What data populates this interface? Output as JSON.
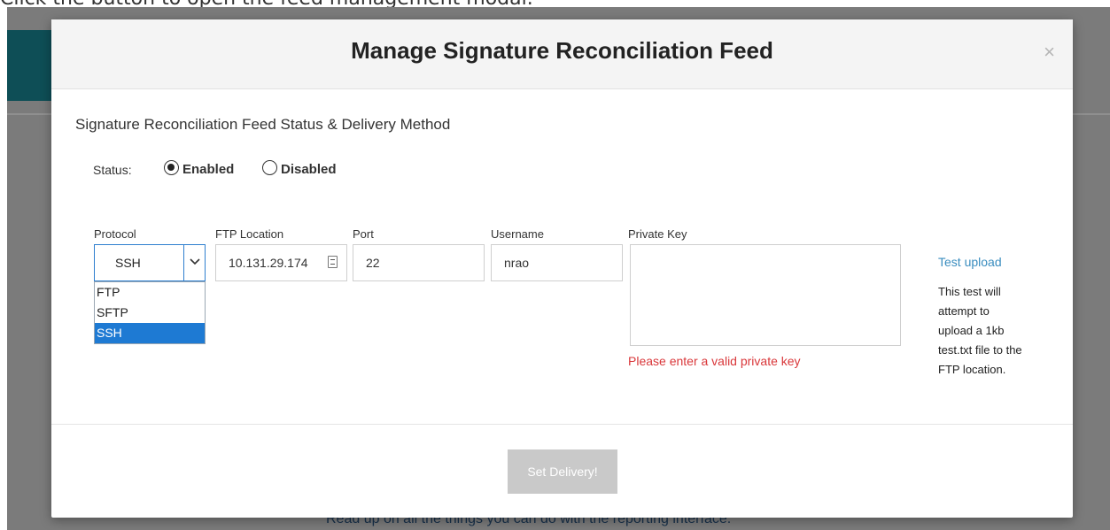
{
  "page_caption": "Click the button to open the feed management modal.",
  "background": {
    "footer_text": "Read up on all the things you can do with the reporting interface."
  },
  "modal": {
    "title": "Manage Signature Reconciliation Feed",
    "close_glyph": "×",
    "section_heading": "Signature Reconciliation Feed Status & Delivery Method",
    "status": {
      "label": "Status:",
      "options": [
        "Enabled",
        "Disabled"
      ],
      "selected": "Enabled"
    },
    "fields": {
      "protocol": {
        "label": "Protocol",
        "value": "SSH",
        "options": [
          "FTP",
          "SFTP",
          "SSH"
        ]
      },
      "ftp_location": {
        "label": "FTP Location",
        "value": "10.131.29.174"
      },
      "port": {
        "label": "Port",
        "value": "22"
      },
      "username": {
        "label": "Username",
        "value": "nrao"
      },
      "private_key": {
        "label": "Private Key",
        "value": "",
        "error": "Please enter a valid private key"
      }
    },
    "test_upload": {
      "link": "Test upload",
      "help": "This test will attempt to upload a 1kb test.txt file to the FTP location."
    },
    "submit_label": "Set Delivery!"
  },
  "colors": {
    "accent": "#1e7ad3",
    "error": "#d9373a",
    "link": "#3a8dbf",
    "header_band": "#0e4e56"
  }
}
